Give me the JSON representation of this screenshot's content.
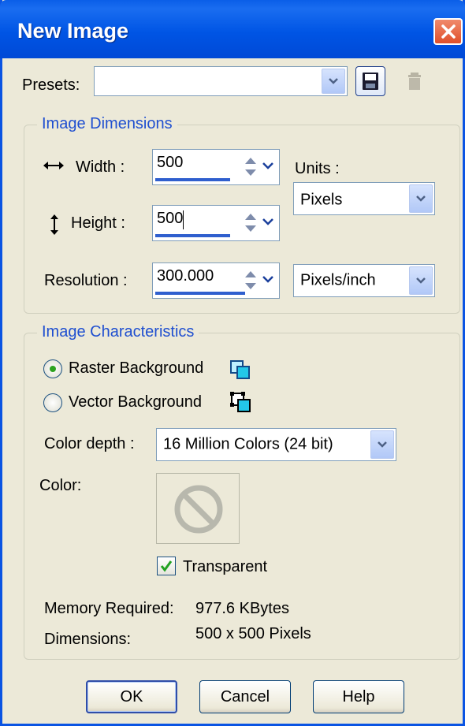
{
  "window": {
    "title": "New Image"
  },
  "presets": {
    "label": "Presets:",
    "value": ""
  },
  "dimensions": {
    "group_title": "Image Dimensions",
    "width_label": "Width :",
    "width_value": "500",
    "height_label": "Height :",
    "height_value": "500",
    "resolution_label": "Resolution :",
    "resolution_value": "300.000",
    "units_label": "Units :",
    "units_value": "Pixels",
    "res_units_value": "Pixels/inch"
  },
  "characteristics": {
    "group_title": "Image Characteristics",
    "raster_label": "Raster Background",
    "vector_label": "Vector Background",
    "raster_selected": true,
    "color_depth_label": "Color depth :",
    "color_depth_value": "16 Million Colors (24 bit)",
    "color_label": "Color:",
    "transparent_label": "Transparent",
    "transparent_checked": true,
    "memory_label": "Memory Required:",
    "memory_value": "977.6 KBytes",
    "dimensions_label": "Dimensions:",
    "dimensions_value": "500 x 500 Pixels"
  },
  "buttons": {
    "ok": "OK",
    "cancel": "Cancel",
    "help": "Help"
  },
  "colors": {
    "accent": "#1f4fd0",
    "title_bar": "#0055e5",
    "face": "#ece9d8",
    "close": "#e0502a"
  }
}
